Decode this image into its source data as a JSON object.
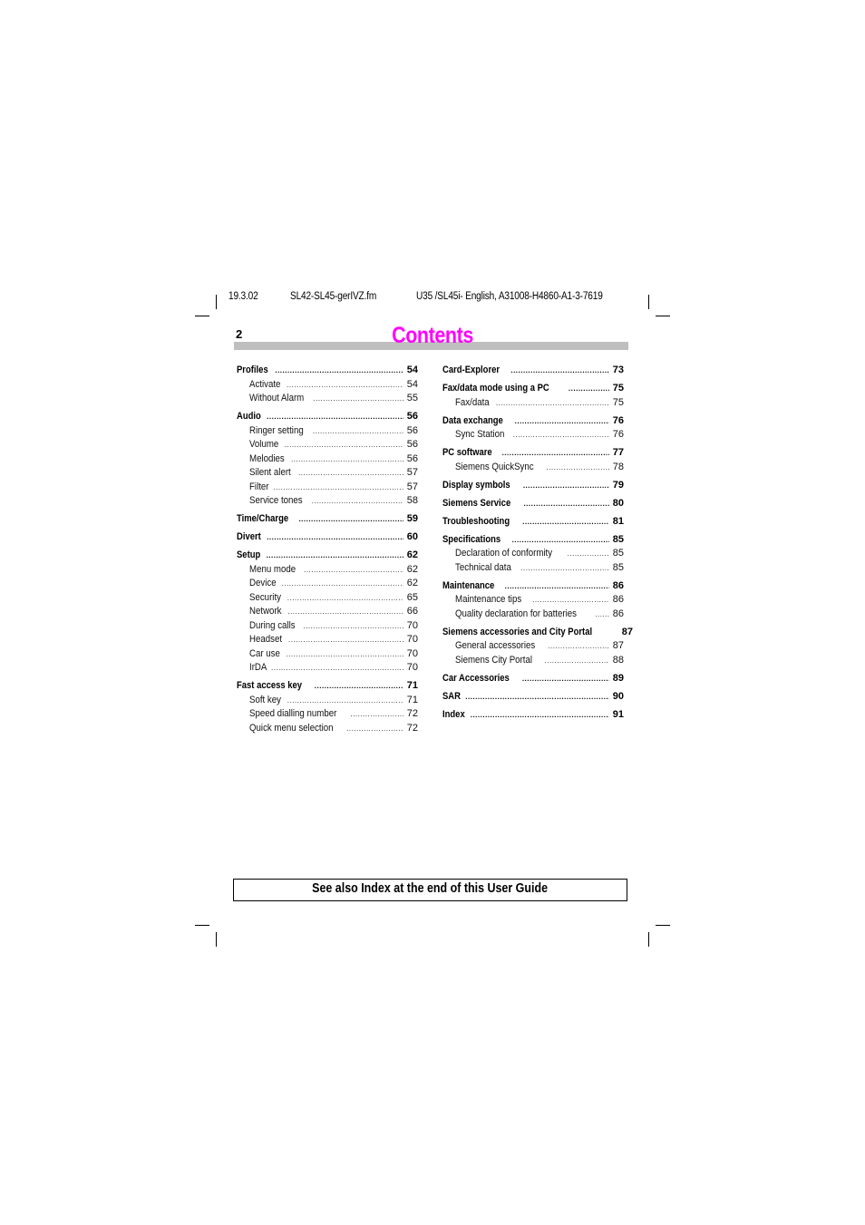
{
  "header": {
    "date": "19.3.02",
    "filename": "SL42-SL45-gerIVZ.fm",
    "doc_id": "U35 /SL45i- English, A31008-H4860-A1-3-7619"
  },
  "page_number": "2",
  "title": "Contents",
  "title_color": "#ff00ff",
  "toc_left": [
    {
      "label": "Profiles",
      "page": "54",
      "level": "main"
    },
    {
      "label": "Activate",
      "page": "54",
      "level": "sub"
    },
    {
      "label": "Without Alarm",
      "page": "55",
      "level": "sub"
    },
    {
      "label": "Audio",
      "page": "56",
      "level": "main"
    },
    {
      "label": "Ringer setting",
      "page": "56",
      "level": "sub"
    },
    {
      "label": "Volume",
      "page": "56",
      "level": "sub"
    },
    {
      "label": "Melodies",
      "page": "56",
      "level": "sub"
    },
    {
      "label": "Silent alert",
      "page": "57",
      "level": "sub"
    },
    {
      "label": "Filter",
      "page": "57",
      "level": "sub"
    },
    {
      "label": "Service tones",
      "page": "58",
      "level": "sub"
    },
    {
      "label": "Time/Charge",
      "page": "59",
      "level": "main"
    },
    {
      "label": "Divert",
      "page": "60",
      "level": "main"
    },
    {
      "label": "Setup",
      "page": "62",
      "level": "main"
    },
    {
      "label": "Menu mode",
      "page": "62",
      "level": "sub"
    },
    {
      "label": "Device",
      "page": "62",
      "level": "sub"
    },
    {
      "label": "Security",
      "page": "65",
      "level": "sub"
    },
    {
      "label": "Network",
      "page": "66",
      "level": "sub"
    },
    {
      "label": "During calls",
      "page": "70",
      "level": "sub"
    },
    {
      "label": "Headset",
      "page": "70",
      "level": "sub"
    },
    {
      "label": "Car use",
      "page": "70",
      "level": "sub"
    },
    {
      "label": "IrDA",
      "page": "70",
      "level": "sub"
    },
    {
      "label": "Fast access key",
      "page": "71",
      "level": "main"
    },
    {
      "label": "Soft key",
      "page": "71",
      "level": "sub"
    },
    {
      "label": "Speed dialling number",
      "page": "72",
      "level": "sub"
    },
    {
      "label": "Quick menu selection",
      "page": "72",
      "level": "sub"
    }
  ],
  "toc_right": [
    {
      "label": "Card-Explorer",
      "page": "73",
      "level": "main"
    },
    {
      "label": "Fax/data mode using a PC",
      "page": "75",
      "level": "main"
    },
    {
      "label": "Fax/data",
      "page": "75",
      "level": "sub"
    },
    {
      "label": "Data exchange",
      "page": "76",
      "level": "main"
    },
    {
      "label": "Sync Station",
      "page": "76",
      "level": "sub"
    },
    {
      "label": "PC software",
      "page": "77",
      "level": "main"
    },
    {
      "label": "Siemens QuickSync",
      "page": "78",
      "level": "sub"
    },
    {
      "label": "Display symbols",
      "page": "79",
      "level": "main"
    },
    {
      "label": "Siemens Service",
      "page": "80",
      "level": "main"
    },
    {
      "label": "Troubleshooting",
      "page": "81",
      "level": "main"
    },
    {
      "label": "Specifications",
      "page": "85",
      "level": "main"
    },
    {
      "label": "Declaration of conformity",
      "page": "85",
      "level": "sub"
    },
    {
      "label": "Technical data",
      "page": "85",
      "level": "sub"
    },
    {
      "label": "Maintenance",
      "page": "86",
      "level": "main"
    },
    {
      "label": "Maintenance tips",
      "page": "86",
      "level": "sub"
    },
    {
      "label": "Quality declaration for batteries",
      "page": "86",
      "level": "sub"
    },
    {
      "label": "Siemens accessories and City Portal",
      "page": "87",
      "level": "main",
      "no_dots": true
    },
    {
      "label": "General accessories",
      "page": "87",
      "level": "sub"
    },
    {
      "label": "Siemens City Portal",
      "page": "88",
      "level": "sub"
    },
    {
      "label": "Car Accessories",
      "page": "89",
      "level": "main"
    },
    {
      "label": "SAR",
      "page": "90",
      "level": "main"
    },
    {
      "label": "Index",
      "page": "91",
      "level": "main"
    }
  ],
  "footer_note": "See also Index at the end of this User Guide"
}
